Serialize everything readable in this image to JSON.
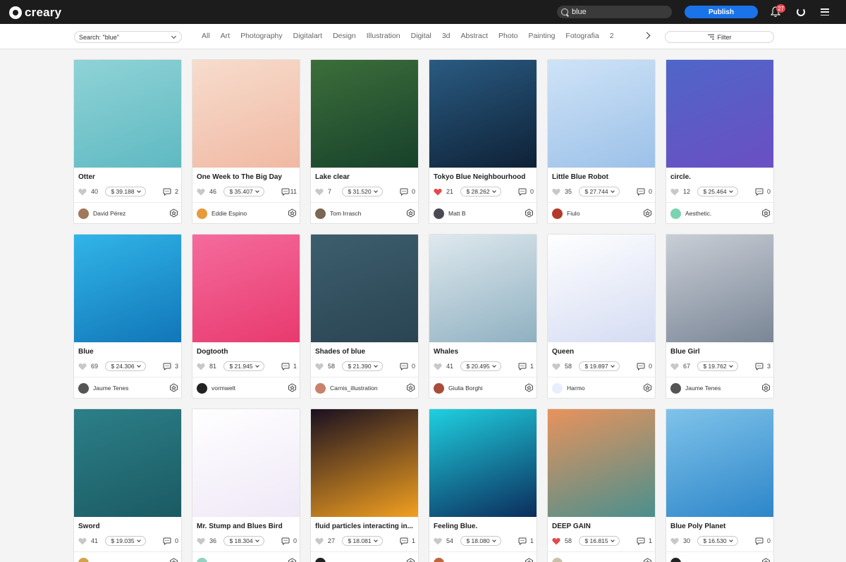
{
  "header": {
    "logo_text": "creary",
    "search_value": "blue",
    "publish_label": "Publish",
    "notification_count": "27"
  },
  "filterbar": {
    "search_select": "Search: \"blue\"",
    "categories": [
      "All",
      "Art",
      "Photography",
      "Digitalart",
      "Design",
      "Illustration",
      "Digital",
      "3d",
      "Abstract",
      "Photo",
      "Painting",
      "Fotografia",
      "2"
    ],
    "filter_label": "Filter"
  },
  "colors": {
    "accent": "#1a73e8",
    "liked_heart": "#e5484d",
    "heart": "#c8c8c8"
  },
  "cards": [
    {
      "title": "Otter",
      "likes": "40",
      "price": "$ 39.188",
      "comments": "2",
      "author": "David Pérez",
      "liked": false,
      "thumb": [
        "#8fd3d6",
        "#5fb9c2"
      ],
      "avatar": "#a0785a"
    },
    {
      "title": "One Week to The Big Day",
      "likes": "46",
      "price": "$ 35.407",
      "comments": "11",
      "author": "Eddie Espino",
      "liked": false,
      "thumb": [
        "#f7dccd",
        "#f0b9a3"
      ],
      "avatar": "#e69a3a"
    },
    {
      "title": "Lake clear",
      "likes": "7",
      "price": "$ 31.520",
      "comments": "0",
      "author": "Tom Irrasch",
      "liked": false,
      "thumb": [
        "#3c6e3a",
        "#17412b"
      ],
      "avatar": "#7a6655"
    },
    {
      "title": "Tokyo Blue Neighbourhood",
      "likes": "21",
      "price": "$ 28.262",
      "comments": "0",
      "author": "Matt B",
      "liked": true,
      "thumb": [
        "#2a5b82",
        "#0e2136"
      ],
      "avatar": "#4a4a55"
    },
    {
      "title": "Little Blue Robot",
      "likes": "35",
      "price": "$ 27.744",
      "comments": "0",
      "author": "Fiulo",
      "liked": false,
      "thumb": [
        "#cfe3f7",
        "#9cc1e8"
      ],
      "avatar": "#b33a2a"
    },
    {
      "title": "circle.",
      "likes": "12",
      "price": "$ 25.464",
      "comments": "0",
      "author": "Aesthetic.",
      "liked": false,
      "thumb": [
        "#4f66c9",
        "#6b4fc2"
      ],
      "avatar": "#7cd3b2"
    },
    {
      "title": "Blue",
      "likes": "69",
      "price": "$ 24.306",
      "comments": "3",
      "author": "Jaume Tenes",
      "liked": false,
      "thumb": [
        "#31b5e8",
        "#1176b8"
      ],
      "avatar": "#555555"
    },
    {
      "title": "Dogtooth",
      "likes": "81",
      "price": "$ 21.945",
      "comments": "1",
      "author": "vormwelt",
      "liked": false,
      "thumb": [
        "#f56b9c",
        "#e83a6f"
      ],
      "avatar": "#222222"
    },
    {
      "title": "Shades of blue",
      "likes": "58",
      "price": "$ 21.390",
      "comments": "0",
      "author": "Carnis_illustration",
      "liked": false,
      "thumb": [
        "#3d5e6e",
        "#2a4452"
      ],
      "avatar": "#c9826b"
    },
    {
      "title": "Whales",
      "likes": "41",
      "price": "$ 20.495",
      "comments": "1",
      "author": "Giulia Borghi",
      "liked": false,
      "thumb": [
        "#dfe9ee",
        "#8fb0c1"
      ],
      "avatar": "#a84d3a"
    },
    {
      "title": "Queen",
      "likes": "58",
      "price": "$ 19.897",
      "comments": "0",
      "author": "Harmo",
      "liked": false,
      "thumb": [
        "#ffffff",
        "#d5dcf3"
      ],
      "avatar": "#e8eefc"
    },
    {
      "title": "Blue Girl",
      "likes": "67",
      "price": "$ 19.762",
      "comments": "3",
      "author": "Jaume Tenes",
      "liked": false,
      "thumb": [
        "#c9ced6",
        "#7a8696"
      ],
      "avatar": "#555555"
    },
    {
      "title": "Sword",
      "likes": "41",
      "price": "$ 19.035",
      "comments": "0",
      "author": "",
      "liked": false,
      "thumb": [
        "#2c7f88",
        "#1b5a63"
      ],
      "avatar": "#d4a24a"
    },
    {
      "title": "Mr. Stump and Blues Bird",
      "likes": "36",
      "price": "$ 18.304",
      "comments": "0",
      "author": "",
      "liked": false,
      "thumb": [
        "#ffffff",
        "#efe8f7"
      ],
      "avatar": "#8fd3c0"
    },
    {
      "title": "fluid particles interacting in...",
      "likes": "27",
      "price": "$ 18.081",
      "comments": "1",
      "author": "",
      "liked": false,
      "thumb": [
        "#1a1020",
        "#f2a020"
      ],
      "avatar": "#222222"
    },
    {
      "title": "Feeling Blue.",
      "likes": "54",
      "price": "$ 18.080",
      "comments": "1",
      "author": "",
      "liked": false,
      "thumb": [
        "#1fd0e0",
        "#0b2d5c"
      ],
      "avatar": "#c2643a"
    },
    {
      "title": "DEEP GAIN",
      "likes": "58",
      "price": "$ 16.815",
      "comments": "1",
      "author": "",
      "liked": true,
      "thumb": [
        "#e8935c",
        "#4a8f8e"
      ],
      "avatar": "#c8c0a8"
    },
    {
      "title": "Blue Poly Planet",
      "likes": "30",
      "price": "$ 16.530",
      "comments": "0",
      "author": "",
      "liked": false,
      "thumb": [
        "#7fc3ea",
        "#2d86c9"
      ],
      "avatar": "#222222"
    }
  ]
}
